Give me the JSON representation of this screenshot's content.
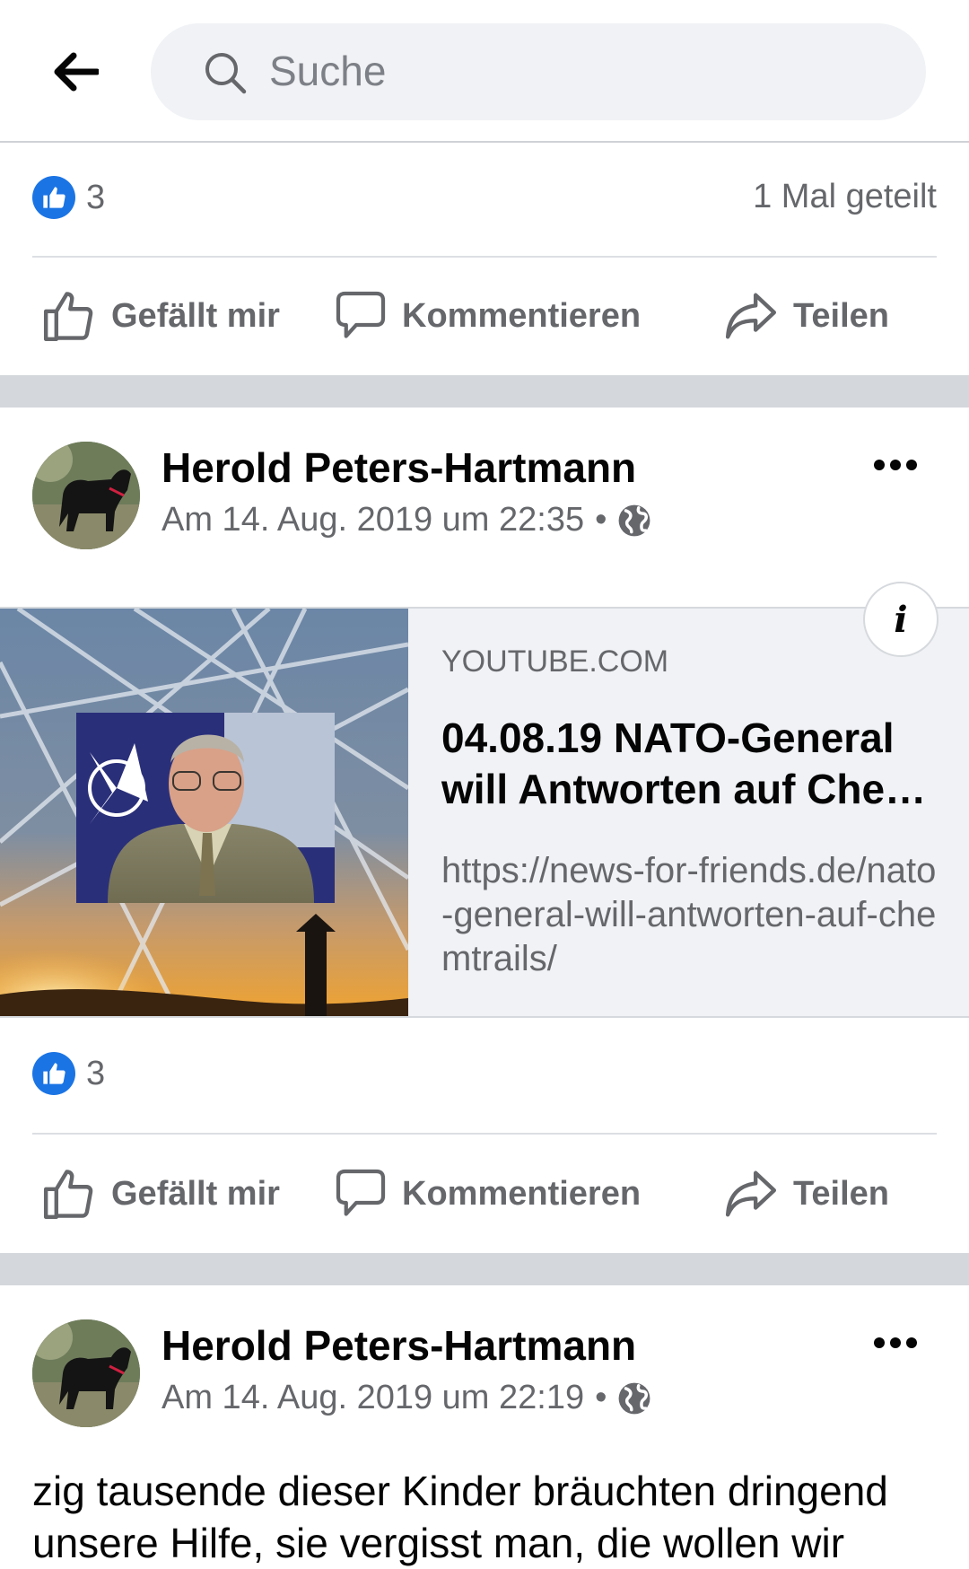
{
  "search": {
    "placeholder": "Suche"
  },
  "post1": {
    "reactions": "3",
    "shares": "1 Mal geteilt",
    "actions": {
      "like": "Gefällt mir",
      "comment": "Kommentieren",
      "share": "Teilen"
    }
  },
  "post2": {
    "author": "Herold Peters-Hartmann",
    "timestamp": "Am 14. Aug. 2019 um 22:35",
    "link": {
      "domain": "YOUTUBE.COM",
      "title": "04.08.19 NATO-General will Antworten auf Che…",
      "url": "https://news-for-friends.de/nato-general-will-antworten-auf-chemtrails/"
    },
    "info_label": "i",
    "reactions": "3",
    "actions": {
      "like": "Gefällt mir",
      "comment": "Kommentieren",
      "share": "Teilen"
    }
  },
  "post3": {
    "author": "Herold Peters-Hartmann",
    "timestamp": "Am 14. Aug. 2019 um 22:19",
    "text": "zig tausende dieser Kinder bräuchten dringend unsere Hilfe, sie vergisst man, die wollen wir"
  },
  "colors": {
    "like_blue": "#1b74e4",
    "secondary_text": "#65676b",
    "separator": "#d4d7db"
  },
  "icons": [
    "back-arrow-icon",
    "search-icon",
    "like-badge-icon",
    "thumbs-up-icon",
    "comment-icon",
    "share-icon",
    "globe-icon",
    "more-icon",
    "info-icon"
  ]
}
